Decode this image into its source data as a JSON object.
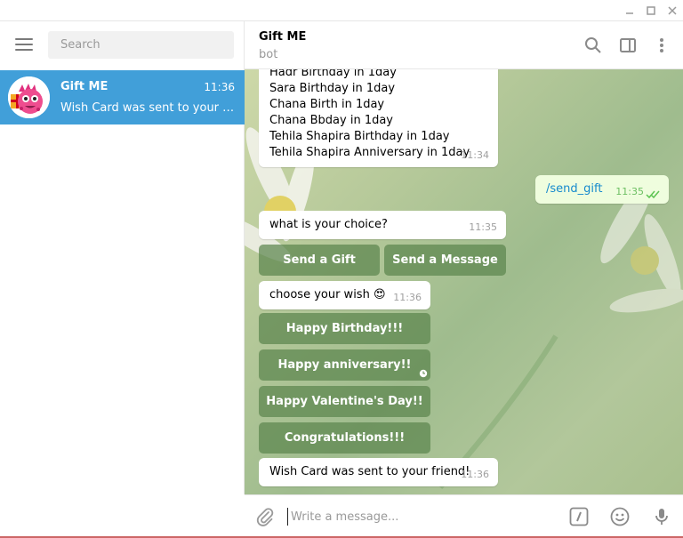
{
  "sidebar": {
    "search_placeholder": "Search",
    "chats": [
      {
        "name": "Gift ME",
        "time": "11:36",
        "preview": "Wish Card was sent to your frie..."
      }
    ]
  },
  "header": {
    "title": "Gift ME",
    "status": "bot"
  },
  "messages": {
    "list_lines": [
      "Hadr Birthday in 1day",
      "Sara Birthday in 1day",
      "Chana Birth in 1day",
      "Chana Bbday in 1day",
      "Tehila Shapira Birthday in 1day",
      "Tehila Shapira Anniversary in 1day"
    ],
    "list_time": "11:34",
    "outgoing_text": "/send_gift",
    "outgoing_time": "11:35",
    "choice_text": "what is your choice?",
    "choice_time": "11:35",
    "choice_buttons": [
      "Send a Gift",
      "Send a Message"
    ],
    "wish_text": "choose your wish",
    "wish_emoji": "😍",
    "wish_time": "11:36",
    "wish_buttons": [
      "Happy Birthday!!!",
      "Happy anniversary!!",
      "Happy Valentine's Day!!",
      "Congratulations!!!"
    ],
    "sent_text": "Wish Card was sent to your friend!",
    "sent_time": "11:36"
  },
  "composer": {
    "placeholder": "Write a message..."
  },
  "colors": {
    "accent": "#419fd9",
    "outgoing_bubble": "#effdde",
    "keyboard_button": "#5c854e"
  },
  "icons": [
    "minimize-icon",
    "maximize-icon",
    "close-icon",
    "menu-icon",
    "search-icon",
    "sidebar-toggle-icon",
    "more-vertical-icon",
    "attach-icon",
    "command-icon",
    "emoji-icon",
    "microphone-icon",
    "double-check-icon",
    "clock-icon"
  ]
}
